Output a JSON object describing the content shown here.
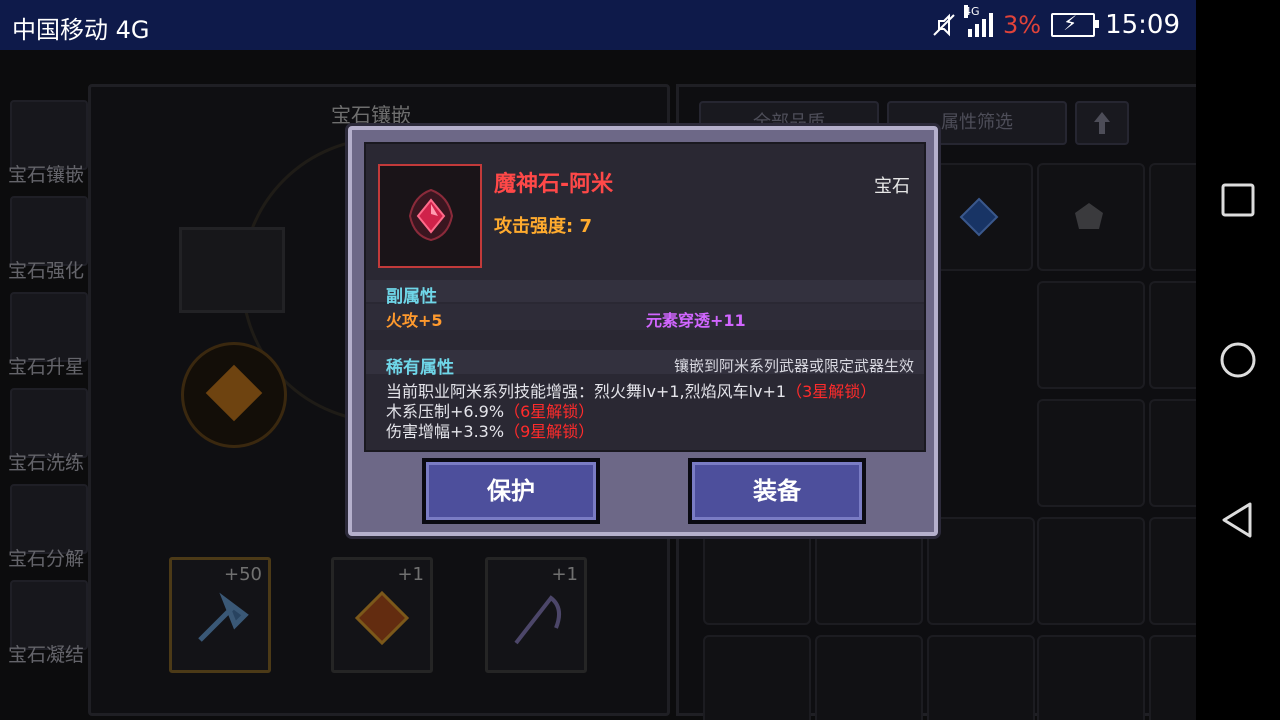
{
  "status_bar": {
    "carrier": "中国移动 4G",
    "network": "4G",
    "battery_percent": "3%",
    "time": "15:09"
  },
  "sidebar": {
    "items": [
      {
        "label": "宝石镶嵌"
      },
      {
        "label": "宝石强化"
      },
      {
        "label": "宝石升星"
      },
      {
        "label": "宝石洗练"
      },
      {
        "label": "宝石分解"
      },
      {
        "label": "宝石凝结"
      }
    ]
  },
  "left_panel": {
    "title": "宝石镶嵌",
    "weapon_slots": [
      {
        "level": "+50"
      },
      {
        "level": "+1"
      },
      {
        "level": "+1"
      }
    ]
  },
  "right_panel": {
    "quality_filter": "全部品质",
    "attribute_filter": "属性筛选"
  },
  "dialog": {
    "gem_name": "魔神石-阿米",
    "type": "宝石",
    "attack": "攻击强度: 7",
    "sub_title": "副属性",
    "sub_attr_1": "火攻+5",
    "sub_attr_2": "元素穿透+11",
    "rare_title": "稀有属性",
    "rare_note": "镶嵌到阿米系列武器或限定武器生效",
    "rare_lines": [
      {
        "text": "当前职业阿米系列技能增强：烈火舞lv+1,烈焰风车lv+1",
        "lock": "（3星解锁）"
      },
      {
        "text": "木系压制+6.9%",
        "lock": "（6星解锁）"
      },
      {
        "text": "伤害增幅+3.3%",
        "lock": "（9星解锁）"
      }
    ],
    "protect_label": "保护",
    "equip_label": "装备"
  },
  "colors": {
    "gem_name": "#ff4848",
    "attack": "#ffab2e",
    "section_title": "#6fd6e8",
    "sub_attr_2": "#d166ff",
    "lock": "#ff2b2b",
    "button": "#4d4f9c"
  }
}
